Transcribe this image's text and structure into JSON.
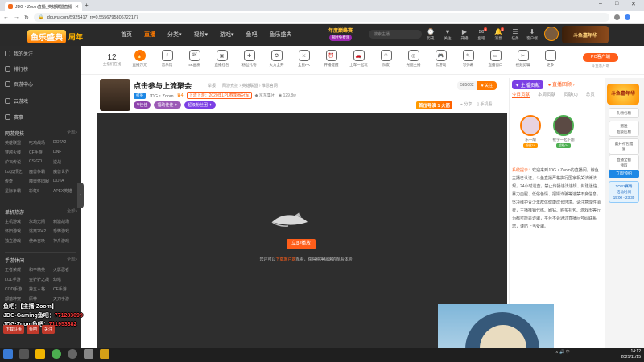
{
  "browser": {
    "tab_title": "JDG・Zoom直播_英雄联盟直播 ·",
    "url": "douyu.com/5925417_rr=0.5556795806722177",
    "window_controls": [
      "–",
      "□",
      "✕"
    ]
  },
  "site": {
    "logo_text": "鱼乐盛典",
    "logo_sub": "周年",
    "nav": [
      "首页",
      "直播",
      "分类▾",
      "视频▾",
      "游戏▾",
      "鱼吧",
      "鱼乐盛典"
    ],
    "active_nav": 1,
    "promo_title": "年度巅峰赛",
    "promo_badge": "限时免费领",
    "search_placeholder": "搜索主播",
    "user_icons": [
      {
        "label": "历史",
        "glyph": "⌚",
        "badge": ""
      },
      {
        "label": "关注",
        "glyph": "♥",
        "badge": ""
      },
      {
        "label": "开播",
        "glyph": "▶",
        "badge": ""
      },
      {
        "label": "鱼吧",
        "glyph": "✉",
        "badge": "9"
      },
      {
        "label": "消息",
        "glyph": "🔔",
        "badge": "4"
      },
      {
        "label": "任务",
        "glyph": "☰",
        "badge": ""
      },
      {
        "label": "客户端",
        "glyph": "⬇",
        "badge": ""
      }
    ],
    "top_ad": "斗鱼嘉年华"
  },
  "sidebar": {
    "top_items": [
      "我的关注",
      "排行榜",
      "页游中心",
      "云游戏",
      "赛事"
    ],
    "sections": [
      {
        "title": "网游竞技",
        "more": "全部>",
        "items": [
          "英雄联盟",
          "吃鸡战场",
          "DOTA2",
          "穿越火线",
          "CF手游",
          "DNF",
          "炉石传说",
          "CS:GO",
          "逆战",
          "Lol云顶之",
          "魔兽争霸",
          "魔兽世界",
          "传奇",
          "魔兽怀旧服",
          "DOTA",
          "星际争霸",
          "彩虹6",
          "APEX英雄"
        ]
      },
      {
        "title": "单机热游",
        "more": "全部>",
        "items": [
          "主机游戏",
          "永劫无间",
          "刺激战场",
          "怀旧游戏",
          "逃离2042",
          "恐怖游戏",
          "独立游戏",
          "使命召唤",
          "神舟游戏"
        ]
      },
      {
        "title": "手游休闲",
        "more": "全部>",
        "items": [
          "王者荣耀",
          "和平精英",
          "火影忍者",
          "LOL手游",
          "金铲铲之战",
          "幻塔",
          "COD手游",
          "第五人格",
          "CF手游",
          "部落冲突",
          "原神",
          "天刀手游"
        ]
      }
    ],
    "overlay_lines": [
      {
        "a": "鱼吧：",
        "b": "【主播·Zoom】",
        "c": ""
      },
      {
        "a": "JDG-Gaming鱼吧：",
        "b": "",
        "c": "771283099"
      },
      {
        "a": "JDG·Zoom鱼吧：",
        "b": "",
        "c": "711953382"
      }
    ],
    "bottom_buttons": [
      "下载斗鱼",
      "鱼吧",
      "关注"
    ]
  },
  "category_bar": {
    "follow_count": "12",
    "follow_label": "主播们在线",
    "items": [
      {
        "label": "直播万元",
        "glyph": "🔥",
        "hot": true
      },
      {
        "label": "音乐馆",
        "glyph": "♫",
        "hot": false
      },
      {
        "label": "4K画质",
        "glyph": "4K",
        "hot": false
      },
      {
        "label": "直播红包",
        "glyph": "▣",
        "hot": false
      },
      {
        "label": "粉丝礼物",
        "glyph": "✚",
        "hot": false
      },
      {
        "label": "火力全开",
        "glyph": "✪",
        "hot": false
      },
      {
        "label": "全民PK",
        "glyph": "⚔",
        "hot": false
      },
      {
        "label": "开播提醒",
        "glyph": "⏰",
        "hot": false
      },
      {
        "label": "上车一起玩",
        "glyph": "🚗",
        "hot": false
      },
      {
        "label": "队友",
        "glyph": "☺",
        "hot": false
      },
      {
        "label": "光圈主播",
        "glyph": "◎",
        "hot": false
      },
      {
        "label": "云游戏",
        "glyph": "🎮",
        "hot": false
      },
      {
        "label": "写弹幕",
        "glyph": "✎",
        "hot": false
      },
      {
        "label": "直播窗口",
        "glyph": "▭",
        "hot": false
      },
      {
        "label": "视频剪辑",
        "glyph": "✂",
        "hot": false
      },
      {
        "label": "更多",
        "glyph": "…",
        "hot": false
      }
    ],
    "pc_client": "PC客户端",
    "pc_client_sub": "斗鱼客户端"
  },
  "streamer": {
    "title": "点击参与上流聚会",
    "report": "举报",
    "categories": "网游竞技 › 英雄联盟 › 维恩官网",
    "badge_pill": "打英",
    "name": "JDG・Zoom",
    "level": "♛4",
    "stat_hot": "上流上游：2020年LPL春季赛冠军",
    "guild": "◆ 京东集团",
    "viewers": "◉ 129.8w",
    "row3_tags": [
      "V佳佳",
      "福助佳佳 ✦",
      "超级粉丝团 ✦"
    ],
    "follow_count": "585002",
    "follow_btn": "♥ 关注",
    "rank_badge": "首位导演 1 火箭",
    "share": "⌁ 分享",
    "phone_watch": "▯ 手机看"
  },
  "player": {
    "play_btn": "立即播放",
    "hint_pre": "您还可以",
    "hint_link": "下载客户端",
    "hint_post": "观看，获得纯净极速的观看体验"
  },
  "right": {
    "rank_header": "✦ 主播贡献",
    "rank_header2": "● 直播回顾 ›",
    "tabs": [
      "今日贡献",
      "本周贡献",
      "贡献(0)",
      "总贡"
    ],
    "active_tab": 0,
    "fans": [
      {
        "name": "乐一胡",
        "badge": "粉丝18"
      },
      {
        "name": "祝学一起下翔",
        "badge": "超级24"
      }
    ],
    "sys_label": "系统提示：",
    "sys_msg": "欢迎来到JDG・Zoom的直播间。鲸鱼主播已认证，斗鱼直播严格执行国家相关法律法规，24小时巡查，禁止传播违法违规、封建迷信、暴力血腥、低俗色情、招嫖诈骗等违禁不良信息，坚决维护青少年群体健康成长环境。请注意理性消费，主播推销代练、刷钻、购买礼包、游戏币等行为都可能是诈骗，平台不会通过直播间号码联系您，谨防上当受骗。"
  },
  "ad_strip": {
    "top": "斗鱼嘉年华",
    "cards": [
      "礼物包粮",
      "赠送\n超级应粮",
      "赢开礼包福\n富",
      "直播全额\n领取"
    ],
    "book": "立即预约",
    "time_title": "TOP1赛场\n活动时间",
    "time_range": "15:00 - 23:30"
  },
  "taskbar": {
    "tray": "∧  🔊  中",
    "time": "14:12",
    "date": "2021/11/15"
  },
  "colors": {
    "accent": "#ff7a00",
    "dark": "#2b2b2b"
  }
}
